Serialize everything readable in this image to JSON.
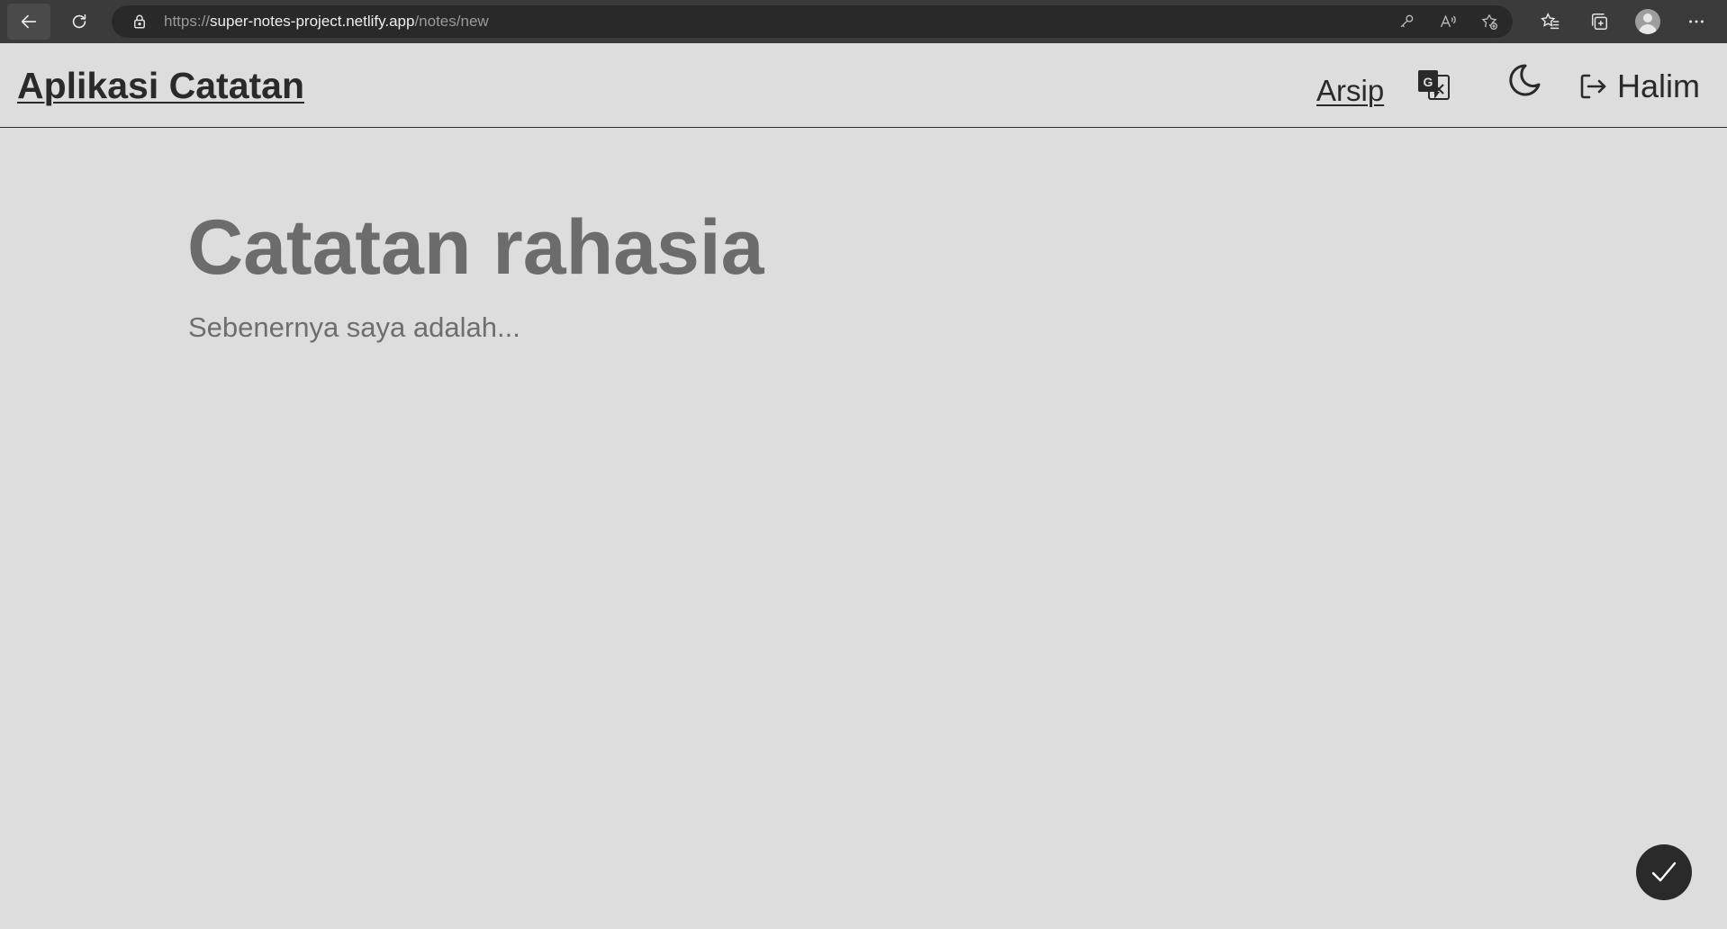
{
  "browser": {
    "url_scheme": "https://",
    "url_host": "super-notes-project.netlify.app",
    "url_path": "/notes/new"
  },
  "header": {
    "app_title": "Aplikasi Catatan",
    "archive_link": "Arsip",
    "user_name": "Halim"
  },
  "note": {
    "title_placeholder": "Catatan rahasia",
    "body_placeholder": "Sebenernya saya adalah..."
  },
  "colors": {
    "page_background": "#dddddd",
    "text_dark": "#2a2a2a",
    "placeholder": "#6c6c6c",
    "browser_bar": "#3b3b3b"
  }
}
